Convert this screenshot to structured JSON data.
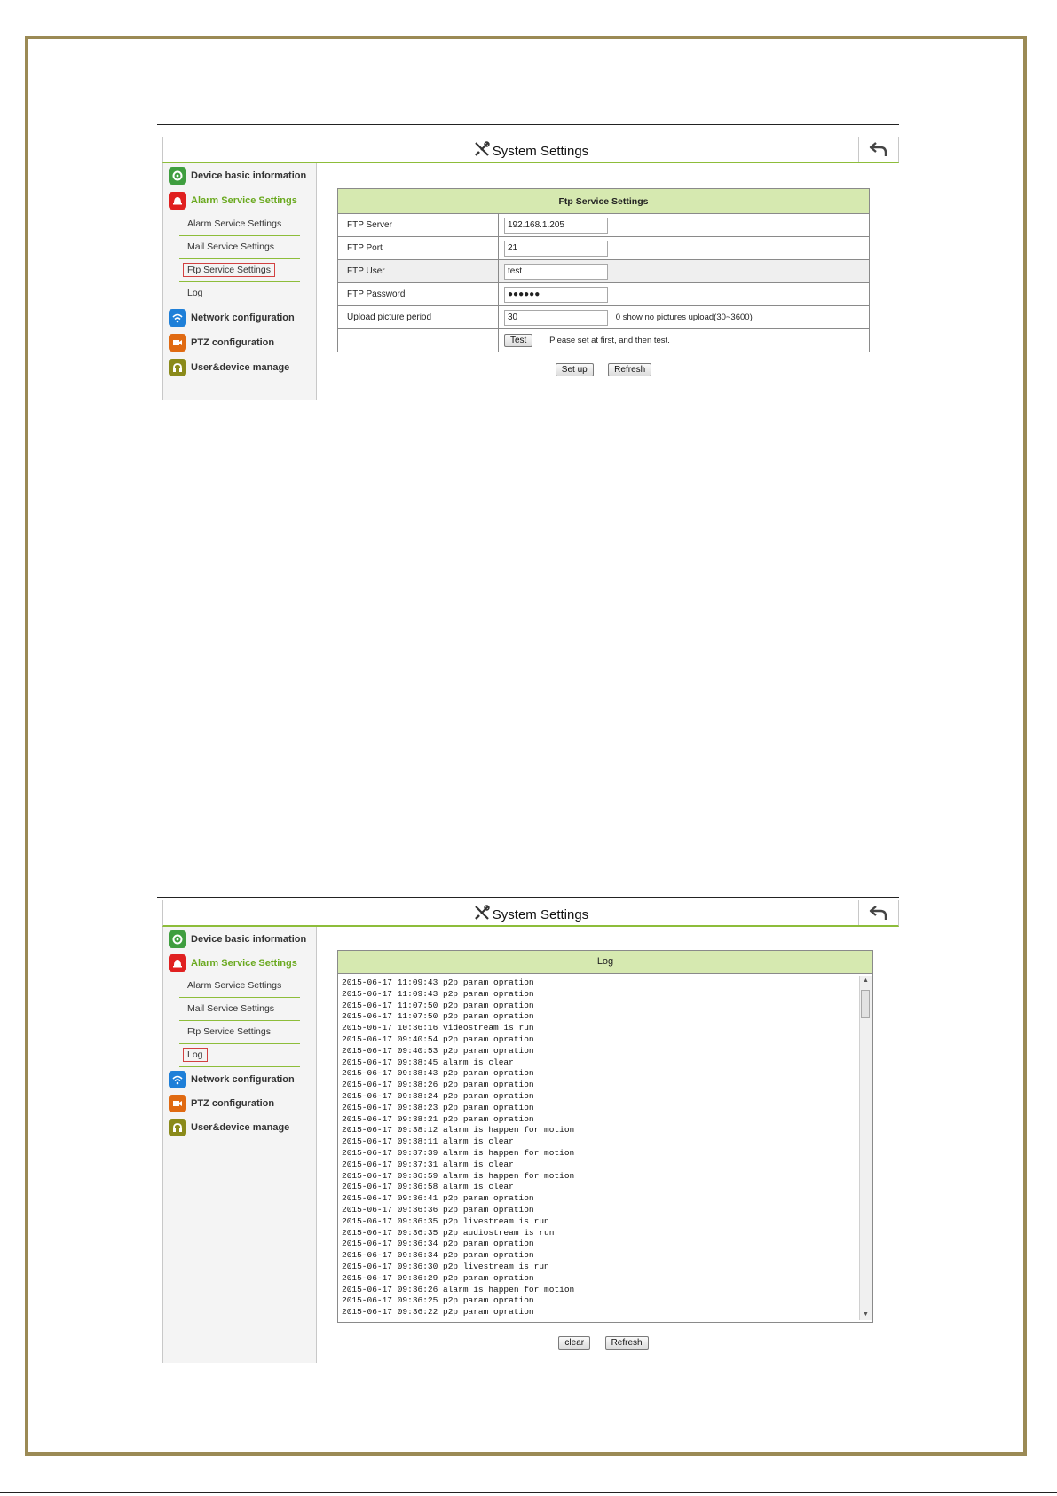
{
  "screen": {
    "title": "System Settings",
    "sidebar": {
      "device_basic": "Device basic information",
      "alarm_service": "Alarm Service Settings",
      "sub_alarm": "Alarm Service Settings",
      "sub_mail": "Mail Service Settings",
      "sub_ftp": "Ftp Service Settings",
      "sub_log": "Log",
      "network": "Network configuration",
      "ptz": "PTZ configuration",
      "user_device": "User&device manage"
    }
  },
  "ftp": {
    "header": "Ftp Service Settings",
    "server_label": "FTP Server",
    "server_value": "192.168.1.205",
    "port_label": "FTP Port",
    "port_value": "21",
    "user_label": "FTP User",
    "user_value": "test",
    "password_label": "FTP Password",
    "password_value": "●●●●●●",
    "period_label": "Upload picture period",
    "period_value": "30",
    "period_hint": "0 show no pictures upload(30~3600)",
    "test_button": "Test",
    "test_hint": "Please set at first, and then test.",
    "setup_button": "Set up",
    "refresh_button": "Refresh"
  },
  "log": {
    "header": "Log",
    "entries": [
      "2015-06-17 11:09:43 p2p param opration",
      "2015-06-17 11:09:43 p2p param opration",
      "2015-06-17 11:07:50 p2p param opration",
      "2015-06-17 11:07:50 p2p param opration",
      "2015-06-17 10:36:16 videostream is run",
      "2015-06-17 09:40:54 p2p param opration",
      "2015-06-17 09:40:53 p2p param opration",
      "2015-06-17 09:38:45 alarm is clear",
      "2015-06-17 09:38:43 p2p param opration",
      "2015-06-17 09:38:26 p2p param opration",
      "2015-06-17 09:38:24 p2p param opration",
      "2015-06-17 09:38:23 p2p param opration",
      "2015-06-17 09:38:21 p2p param opration",
      "2015-06-17 09:38:12 alarm is happen for motion",
      "2015-06-17 09:38:11 alarm is clear",
      "2015-06-17 09:37:39 alarm is happen for motion",
      "2015-06-17 09:37:31 alarm is clear",
      "2015-06-17 09:36:59 alarm is happen for motion",
      "2015-06-17 09:36:58 alarm is clear",
      "2015-06-17 09:36:41 p2p param opration",
      "2015-06-17 09:36:36 p2p param opration",
      "2015-06-17 09:36:35 p2p livestream is run",
      "2015-06-17 09:36:35 p2p audiostream is run",
      "2015-06-17 09:36:34 p2p param opration",
      "2015-06-17 09:36:34 p2p param opration",
      "2015-06-17 09:36:30 p2p livestream is run",
      "2015-06-17 09:36:29 p2p param opration",
      "2015-06-17 09:36:26 alarm is happen for motion",
      "2015-06-17 09:36:25 p2p param opration",
      "2015-06-17 09:36:22 p2p param opration"
    ],
    "clear_button": "clear",
    "refresh_button": "Refresh"
  }
}
